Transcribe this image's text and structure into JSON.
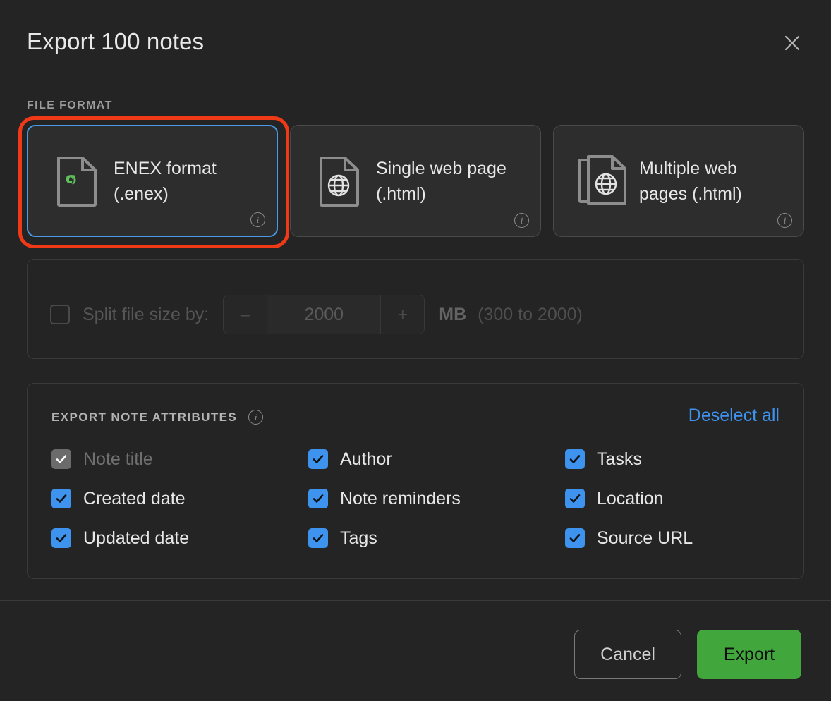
{
  "dialog": {
    "title": "Export 100 notes",
    "close_icon": "close-icon"
  },
  "file_format": {
    "label": "FILE FORMAT",
    "selected_index": 0,
    "highlight_color": "#f03a17",
    "selected_border_color": "#4a9ae8",
    "options": [
      {
        "label": "ENEX format (.enex)",
        "icon": "evernote-document-icon",
        "info_icon": "info-icon",
        "selected": true,
        "highlighted": true
      },
      {
        "label": "Single web page (.html)",
        "icon": "web-document-icon",
        "info_icon": "info-icon",
        "selected": false,
        "highlighted": false
      },
      {
        "label": "Multiple web pages (.html)",
        "icon": "multiple-web-documents-icon",
        "info_icon": "info-icon",
        "selected": false,
        "highlighted": false
      }
    ]
  },
  "split": {
    "checkbox_label": "Split file size by:",
    "checked": false,
    "disabled": true,
    "decrement_label": "–",
    "increment_label": "+",
    "value": "2000",
    "unit": "MB",
    "range_hint": "(300 to 2000)"
  },
  "attributes": {
    "title": "EXPORT NOTE ATTRIBUTES",
    "info_icon": "info-icon",
    "deselect_all_label": "Deselect all",
    "deselect_all_color": "#3d93ee",
    "items": [
      {
        "label": "Note title",
        "checked": true,
        "disabled": true
      },
      {
        "label": "Author",
        "checked": true,
        "disabled": false
      },
      {
        "label": "Tasks",
        "checked": true,
        "disabled": false
      },
      {
        "label": "Created date",
        "checked": true,
        "disabled": false
      },
      {
        "label": "Note reminders",
        "checked": true,
        "disabled": false
      },
      {
        "label": "Location",
        "checked": true,
        "disabled": false
      },
      {
        "label": "Updated date",
        "checked": true,
        "disabled": false
      },
      {
        "label": "Tags",
        "checked": true,
        "disabled": false
      },
      {
        "label": "Source URL",
        "checked": true,
        "disabled": false
      }
    ]
  },
  "footer": {
    "cancel_label": "Cancel",
    "export_label": "Export",
    "export_color": "#41a63c"
  }
}
